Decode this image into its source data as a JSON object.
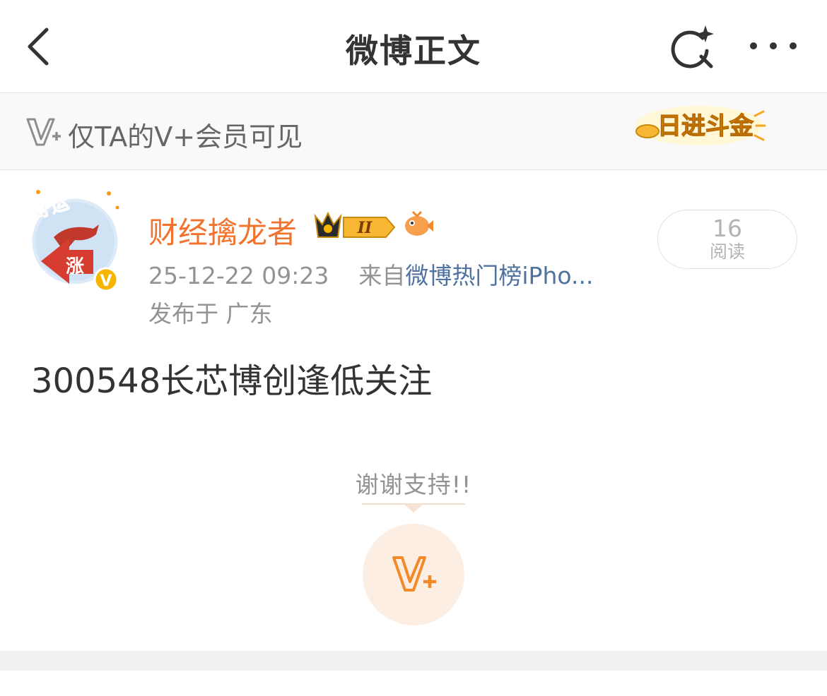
{
  "nav": {
    "title": "微博正文",
    "back_icon": "chevron-left-icon",
    "search_icon": "sparkle-search-icon",
    "more_icon": "more-dots-icon"
  },
  "vip_banner": {
    "text": "仅TA的V+会员可见",
    "icon": "v-plus-icon",
    "sticker_text": "日进斗金"
  },
  "author": {
    "name": "财经擒龙者",
    "avatar_text_top": "好运",
    "avatar_text_bottom": "涨",
    "verified_mark": "V",
    "crown_badge_text": "II",
    "time": "25-12-22 09:23",
    "from_label": "来自",
    "source": "微博热门榜iPho...",
    "location": "发布于 广东"
  },
  "read_stats": {
    "count": "16",
    "label": "阅读"
  },
  "post": {
    "text": "300548长芯博创逢低关注"
  },
  "reward": {
    "thanks": "谢谢支持!!",
    "button_icon": "v-plus-icon"
  },
  "colors": {
    "accent_orange": "#f2732e",
    "link_blue": "#50729f",
    "meta_gray": "#939393",
    "v_plus_orange": "#f28a29",
    "reward_bg": "#fdeee3"
  }
}
